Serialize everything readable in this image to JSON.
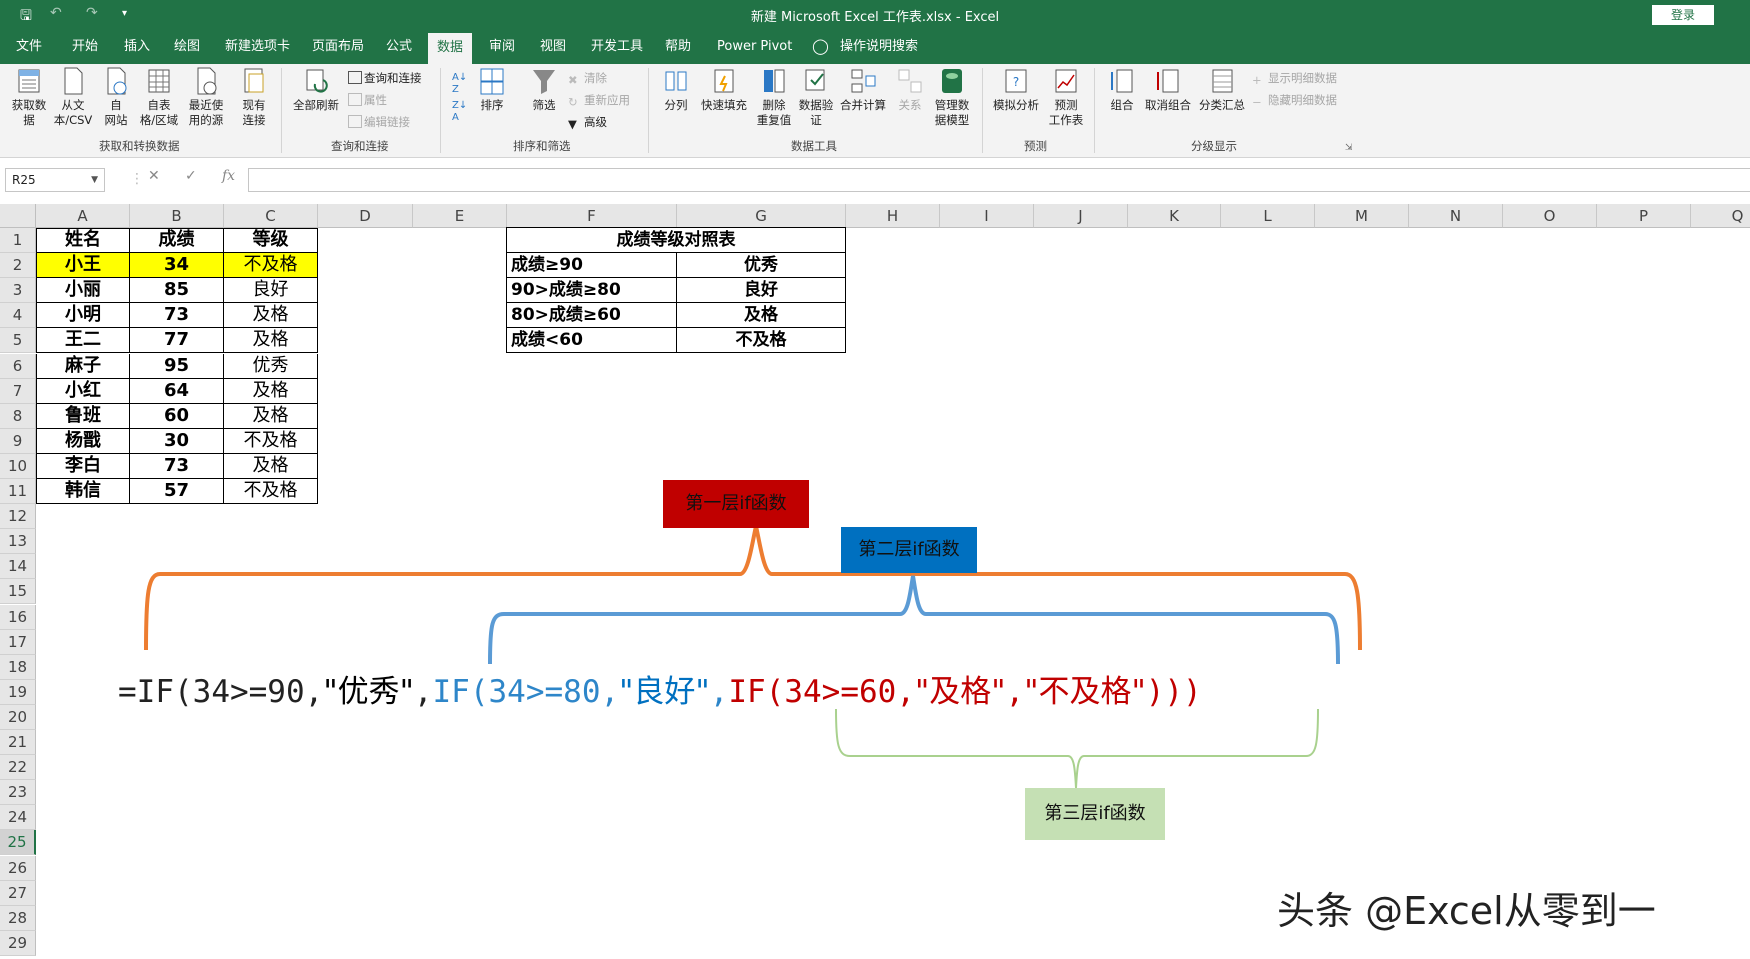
{
  "window": {
    "title": "新建 Microsoft Excel 工作表.xlsx  -  Excel",
    "login_label": "登录"
  },
  "tabs": [
    {
      "label": "文件"
    },
    {
      "label": "开始"
    },
    {
      "label": "插入"
    },
    {
      "label": "绘图"
    },
    {
      "label": "新建选项卡"
    },
    {
      "label": "页面布局"
    },
    {
      "label": "公式"
    },
    {
      "label": "数据"
    },
    {
      "label": "审阅"
    },
    {
      "label": "视图"
    },
    {
      "label": "开发工具"
    },
    {
      "label": "帮助"
    },
    {
      "label": "Power Pivot"
    },
    {
      "label": "操作说明搜索"
    }
  ],
  "ribbon": {
    "get_data": "获取数\n据",
    "from_text": "从文\n本/CSV",
    "from_web": "自\n网站",
    "from_table": "自表\n格/区域",
    "recent_sources": "最近使\n用的源",
    "existing_conn": "现有\n连接",
    "refresh_all": "全部刷新",
    "queries_conn": "查询和连接",
    "properties": "属性",
    "edit_links": "编辑链接",
    "sort_az": "A→Z",
    "sort": "排序",
    "filter": "筛选",
    "clear": "清除",
    "reapply": "重新应用",
    "advanced": "高级",
    "text_to_cols": "分列",
    "flash_fill": "快速填充",
    "remove_dup": "删除\n重复值",
    "validation": "数据验\n证",
    "consolidate": "合并计算",
    "relations": "关系",
    "manage_model": "管理数\n据模型",
    "what_if": "模拟分析",
    "forecast": "预测\n工作表",
    "group": "组合",
    "ungroup": "取消组合",
    "subtotal": "分类汇总",
    "show_detail": "显示明细数据",
    "hide_detail": "隐藏明细数据",
    "groups": {
      "get_transform": "获取和转换数据",
      "queries": "查询和连接",
      "sort_filter": "排序和筛选",
      "data_tools": "数据工具",
      "forecast": "预测",
      "outline": "分级显示"
    }
  },
  "formula_bar": {
    "name_box": "R25",
    "cancel_icon": "✕",
    "enter_icon": "✓",
    "fx_label": "fx",
    "value": ""
  },
  "columns": [
    "A",
    "B",
    "C",
    "D",
    "E",
    "F",
    "G",
    "H",
    "I",
    "J",
    "K",
    "L",
    "M",
    "N",
    "O",
    "P",
    "Q"
  ],
  "rows": [
    "1",
    "2",
    "3",
    "4",
    "5",
    "6",
    "7",
    "8",
    "9",
    "10",
    "11",
    "12",
    "13",
    "14",
    "15",
    "16",
    "17",
    "18",
    "19",
    "20",
    "21",
    "22",
    "23",
    "24",
    "25",
    "26",
    "27",
    "28",
    "29"
  ],
  "table": {
    "headers": [
      "姓名",
      "成绩",
      "等级"
    ],
    "rows": [
      [
        "小王",
        "34",
        "不及格"
      ],
      [
        "小丽",
        "85",
        "良好"
      ],
      [
        "小明",
        "73",
        "及格"
      ],
      [
        "王二",
        "77",
        "及格"
      ],
      [
        "麻子",
        "95",
        "优秀"
      ],
      [
        "小红",
        "64",
        "及格"
      ],
      [
        "鲁班",
        "60",
        "及格"
      ],
      [
        "杨戬",
        "30",
        "不及格"
      ],
      [
        "李白",
        "73",
        "及格"
      ],
      [
        "韩信",
        "57",
        "不及格"
      ]
    ]
  },
  "grade_table": {
    "title": "成绩等级对照表",
    "rows": [
      [
        "成绩≥90",
        "优秀"
      ],
      [
        "90>成绩≥80",
        "良好"
      ],
      [
        "80>成绩≥60",
        "及格"
      ],
      [
        "成绩<60",
        "不及格"
      ]
    ]
  },
  "annotations": {
    "layer1": "第一层if函数",
    "layer2": "第二层if函数",
    "layer3": "第三层if函数",
    "colors": {
      "layer1": "#c00000",
      "layer2": "#0070c0",
      "layer3": "#c5e0b4",
      "brace1": "#ed7d31",
      "brace2": "#5b9bd5",
      "brace3": "#a9d18e"
    }
  },
  "formula": {
    "p1": "=IF(34>=90,",
    "p1s": "\"优秀\"",
    "p1c": ",",
    "p2": "IF(34>=80,",
    "p2s": "\"良好\"",
    "p2c": ",",
    "p3": "IF(34>=60,",
    "p3s": "\"及格\"",
    "p3c": ",",
    "p3s2": "\"不及格\"",
    "p3e": ")))"
  },
  "watermark": "头条 @Excel从零到一"
}
